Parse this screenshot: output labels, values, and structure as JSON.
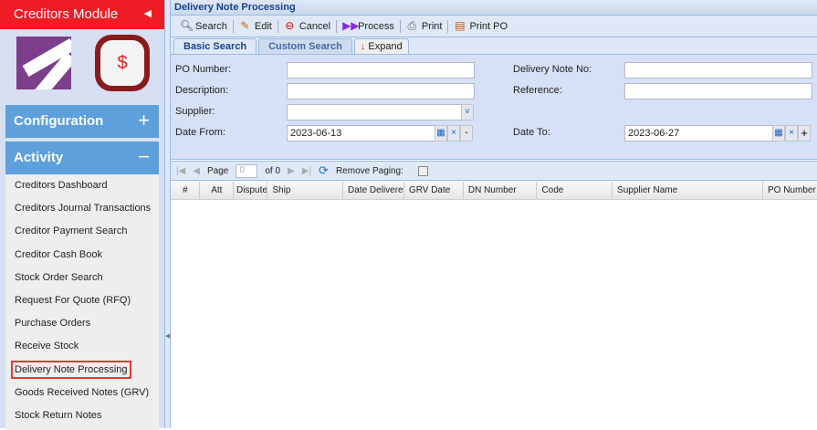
{
  "sidebar": {
    "title": "Creditors Module",
    "sections": [
      {
        "label": "Configuration",
        "toggle": "+"
      },
      {
        "label": "Activity",
        "toggle": "−"
      }
    ],
    "items": [
      "Creditors Dashboard",
      "Creditors Journal Transactions",
      "Creditor Payment Search",
      "Creditor Cash Book",
      "Stock Order Search",
      "Request For Quote (RFQ)",
      "Purchase Orders",
      "Receive Stock",
      "Delivery Note Processing",
      "Goods Received Notes (GRV)",
      "Stock Return Notes"
    ],
    "selected": "Delivery Note Processing"
  },
  "main": {
    "title": "Delivery Note Processing",
    "toolbar": [
      "Search",
      "Edit",
      "Cancel",
      "Process",
      "Print",
      "Print PO"
    ],
    "tabs": [
      "Basic Search",
      "Custom Search",
      "Expand"
    ],
    "form": {
      "po_number_label": "PO Number:",
      "description_label": "Description:",
      "supplier_label": "Supplier:",
      "date_from_label": "Date From:",
      "dn_no_label": "Delivery Note No:",
      "reference_label": "Reference:",
      "date_to_label": "Date To:",
      "date_from": "2023-06-13",
      "date_to": "2023-06-27"
    },
    "pager": {
      "page_label": "Page",
      "page_value": "0",
      "of_label": "of 0",
      "remove_paging": "Remove Paging:"
    },
    "columns": [
      "#",
      "Att",
      "Dispute",
      "Ship",
      "Date Delivered",
      "GRV Date",
      "DN Number",
      "Code",
      "Supplier Name",
      "PO Number"
    ]
  }
}
